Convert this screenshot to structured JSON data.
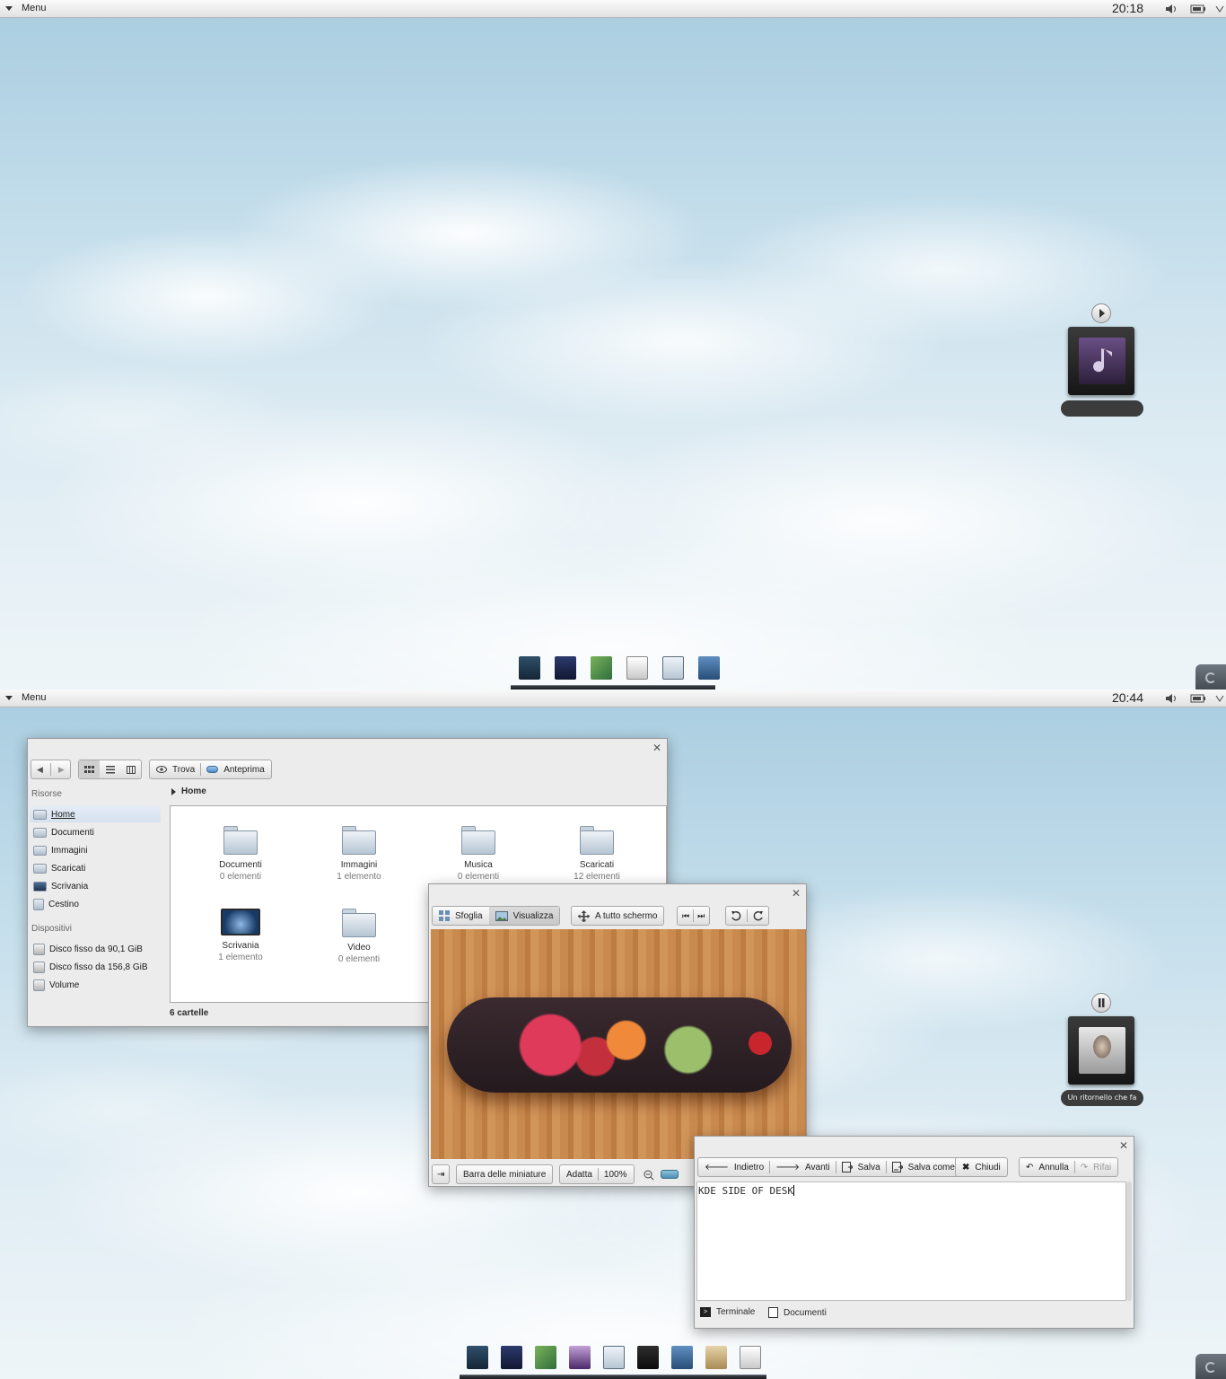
{
  "top_screen": {
    "menu_label": "Menu",
    "clock": "20:18",
    "music_widget": {
      "state": "play",
      "caption": ""
    }
  },
  "bottom_screen": {
    "menu_label": "Menu",
    "clock": "20:44",
    "music_widget": {
      "state": "pause",
      "caption": "Un ritornello che fa"
    },
    "file_manager": {
      "toolbar": {
        "find_label": "Trova",
        "preview_label": "Anteprima"
      },
      "sidebar": {
        "places_heading": "Risorse",
        "places": [
          {
            "label": "Home"
          },
          {
            "label": "Documenti"
          },
          {
            "label": "Immagini"
          },
          {
            "label": "Scaricati"
          },
          {
            "label": "Scrivania"
          },
          {
            "label": "Cestino"
          }
        ],
        "devices_heading": "Dispositivi",
        "devices": [
          {
            "label": "Disco fisso da 90,1 GiB"
          },
          {
            "label": "Disco fisso da 156,8 GiB"
          },
          {
            "label": "Volume"
          }
        ]
      },
      "breadcrumb": "Home",
      "folders": [
        {
          "name": "Documenti",
          "count": "0 elementi"
        },
        {
          "name": "Immagini",
          "count": "1 elemento"
        },
        {
          "name": "Musica",
          "count": "0 elementi"
        },
        {
          "name": "Scaricati",
          "count": "12 elementi"
        },
        {
          "name": "Scrivania",
          "count": "1 elemento"
        },
        {
          "name": "Video",
          "count": "0 elementi"
        }
      ],
      "status": "6 cartelle"
    },
    "image_viewer": {
      "toolbar": {
        "browse_label": "Sfoglia",
        "view_label": "Visualizza",
        "fullscreen_label": "A tutto schermo"
      },
      "bottom": {
        "thumbnail_bar_label": "Barra delle miniature",
        "fit_label": "Adatta",
        "zoom_value": "100%"
      }
    },
    "text_editor": {
      "toolbar": {
        "back_label": "Indietro",
        "forward_label": "Avanti",
        "save_label": "Salva",
        "save_as_label": "Salva come",
        "close_label": "Chiudi",
        "undo_label": "Annulla",
        "redo_label": "Rifai"
      },
      "content": "KDE SIDE OF DESK",
      "panels": {
        "terminal_label": "Terminale",
        "documents_label": "Documenti"
      }
    }
  }
}
